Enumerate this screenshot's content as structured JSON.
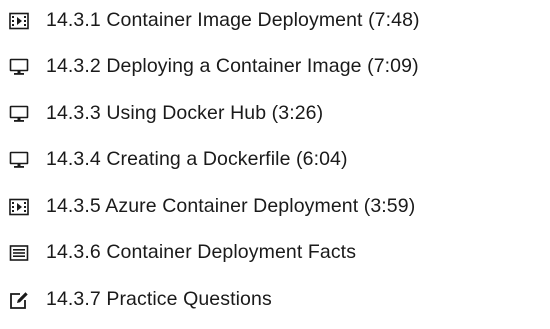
{
  "items": [
    {
      "icon": "video-icon",
      "label": "14.3.1 Container Image Deployment (7:48)"
    },
    {
      "icon": "monitor-icon",
      "label": "14.3.2 Deploying a Container Image (7:09)"
    },
    {
      "icon": "monitor-icon",
      "label": "14.3.3 Using Docker Hub (3:26)"
    },
    {
      "icon": "monitor-icon",
      "label": "14.3.4 Creating a Dockerfile (6:04)"
    },
    {
      "icon": "video-icon",
      "label": "14.3.5 Azure Container Deployment (3:59)"
    },
    {
      "icon": "document-icon",
      "label": "14.3.6 Container Deployment Facts"
    },
    {
      "icon": "edit-icon",
      "label": "14.3.7 Practice Questions"
    }
  ]
}
